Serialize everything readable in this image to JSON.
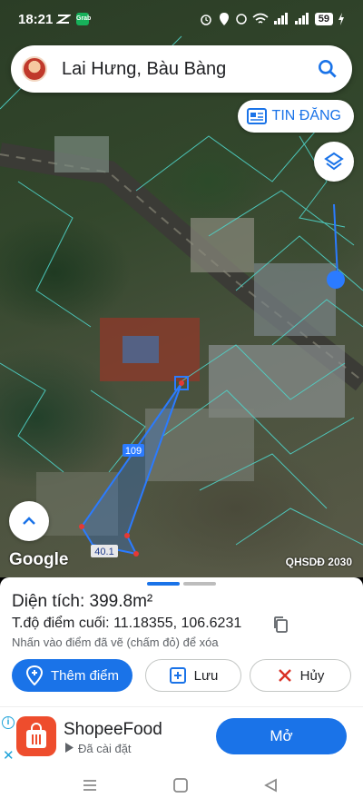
{
  "status_bar": {
    "time": "18:21",
    "battery": "59",
    "grab_label": "Grab"
  },
  "search": {
    "title": "Lai Hưng, Bàu Bàng"
  },
  "map": {
    "tin_dang_label": "TIN ĐĂNG",
    "google_label": "Google",
    "layer_label": "QHSDĐ 2030",
    "segment_label_1": "109",
    "segment_label_2": "40.1"
  },
  "sheet": {
    "area_prefix": "Diện tích: ",
    "area_value": "399.8m²",
    "coord_prefix": "T.độ điểm cuối: ",
    "coord_value": "11.18355, 106.6231",
    "hint": "Nhấn vào điểm đã vẽ (chấm đỏ) để xóa",
    "add_point_label": "Thêm điểm",
    "save_label": "Lưu",
    "cancel_label": "Hủy"
  },
  "ad": {
    "name": "ShopeeFood",
    "sub": "Đã cài đặt",
    "open_label": "Mở",
    "info_label": "i",
    "close_label": "✕"
  },
  "colors": {
    "accent": "#1a73e8",
    "parcel_line": "#4fd3c8",
    "measure_line": "#2b7bff",
    "shopee": "#ee4d2d"
  }
}
